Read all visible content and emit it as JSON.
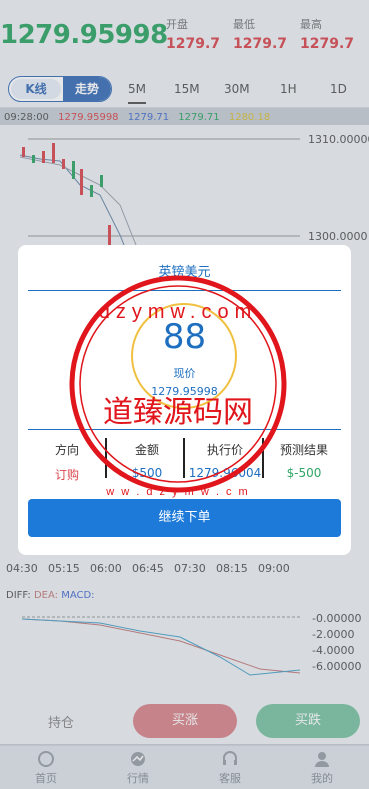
{
  "header": {
    "price": "1279.95998",
    "open_label": "开盘",
    "open_value": "1279.7",
    "low_label": "最低",
    "low_value": "1279.7",
    "high_label": "最高",
    "high_value": "1279.7"
  },
  "tabs": {
    "kline": "K线",
    "trend": "走势",
    "intervals": [
      "5M",
      "15M",
      "30M",
      "1H",
      "1D"
    ]
  },
  "legend": {
    "time": "09:28:00",
    "v1": "1279.95998",
    "v2": "1279.71",
    "v3": "1279.71",
    "v4": "1280.18"
  },
  "chart_data": {
    "type": "line",
    "y_ticks": [
      "1310.00000",
      "1300.0000"
    ],
    "x_ticks": [
      "04:30",
      "05:15",
      "06:00",
      "06:45",
      "07:30",
      "08:15",
      "09:00"
    ],
    "macd_label": "DIFF:",
    "dea_label": "DEA:",
    "macd_name": "MACD:",
    "macd_ticks": [
      "-0.00000",
      "-2.0000",
      "-4.0000",
      "-6.00000"
    ]
  },
  "modal": {
    "title": "英镑美元",
    "countdown": "88",
    "current_label": "现价",
    "current_value": "1279.95998",
    "columns": [
      {
        "header": "方向",
        "value": "订购"
      },
      {
        "header": "金额",
        "value": "$500"
      },
      {
        "header": "执行价",
        "value": "1279.96004"
      },
      {
        "header": "预测结果",
        "value": "$-500"
      }
    ],
    "continue": "继续下单"
  },
  "actions": {
    "hold": "持仓",
    "buy_up": "买涨",
    "buy_down": "买跌"
  },
  "nav": {
    "items": [
      "首页",
      "行情",
      "客服",
      "我的"
    ]
  },
  "watermark": {
    "top": "dzymw.com",
    "ring_top": "w w . d z y m w . c o m",
    "main": "道臻源码网",
    "bottom": "w w . d z y m w . c m"
  },
  "colors": {
    "up": "#d9484f",
    "down": "#2fa565",
    "accent": "#1e6fc0",
    "button": "#1d7ad9",
    "watermark": "#e0161c"
  }
}
